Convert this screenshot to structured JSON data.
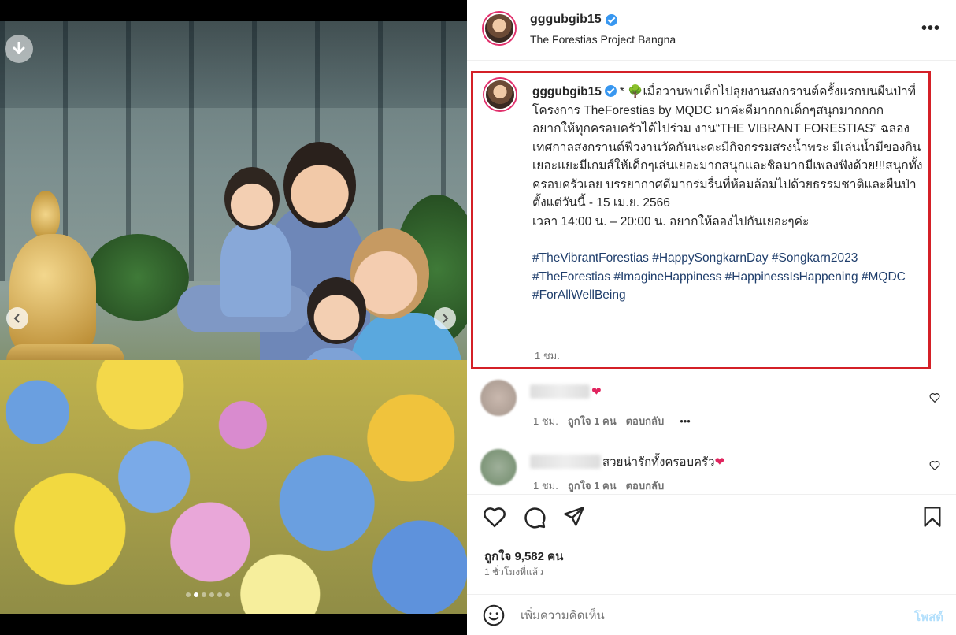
{
  "post": {
    "username": "gggubgib15",
    "location": "The Forestias Project Bangna",
    "more_icon": "more-horizontal-icon"
  },
  "caption": {
    "username": "gggubgib15",
    "line1": "* 🌳เมื่อวานพาเด็กไปลุยงานสงกรานต์ครั้งแรกบนผืนป่าที่โครงการ TheForestias by MQDC มาค่ะดีมากกกเด็กๆสนุกมากกกก",
    "line2": "อยากให้ทุกครอบครัวได้ไปร่วม งาน“THE VIBRANT FORESTIAS” ฉลองเทศกาลสงกรานต์ฟีวงานวัดกันนะคะมีกิจกรรมสรงน้ำพระ มีเล่นน้ำมีของกินเยอะแยะมีเกมส์ให้เด็กๆเล่นเยอะมากสนุกและชิลมากมีเพลงฟังด้วย!!!สนุกทั้งครอบครัวเลย บรรยากาศดีมากร่มรื่นที่ห้อมล้อมไปด้วยธรรมชาติและผืนป่า",
    "line3": "ตั้งแต่วันนี้ - 15 เม.ย. 2566",
    "line4": "เวลา 14:00 น. – 20:00 น. อยากให้ลองไปกันเยอะๆค่ะ",
    "hashtags": "#TheVibrantForestias #HappySongkarnDay #Songkarn2023 #TheForestias #ImagineHappiness #HappinessIsHappening #MQDC #ForAllWellBeing",
    "time": "1 ชม."
  },
  "comments": [
    {
      "text": "",
      "time": "1 ชม.",
      "likes": "ถูกใจ 1 คน",
      "reply": "ตอบกลับ",
      "more": "•••"
    },
    {
      "text": "สวยน่ารักทั้งครอบครัว",
      "time": "1 ชม.",
      "likes": "ถูกใจ 1 คน",
      "reply": "ตอบกลับ"
    }
  ],
  "actions": {
    "likes_count": "ถูกใจ 9,582 คน",
    "posted_ago": "1 ชั่วโมงที่แล้ว"
  },
  "composer": {
    "placeholder": "เพิ่มความคิดเห็น",
    "post_label": "โพสต์"
  },
  "carousel": {
    "slide_count": 6,
    "active_slide": 1
  },
  "colors": {
    "highlight_border": "#d42027",
    "hashtag": "#1e3d6b",
    "verified": "#3897f0",
    "post_button_disabled": "#b2dffc"
  }
}
